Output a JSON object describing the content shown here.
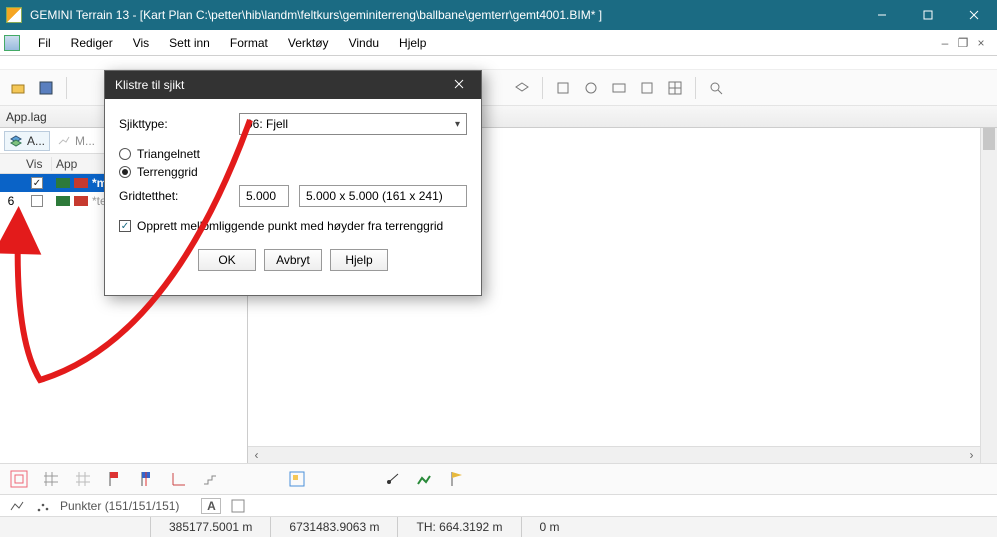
{
  "window": {
    "title": "GEMINI Terrain 13 - [Kart  Plan  C:\\petter\\hib\\landm\\feltkurs\\geminiterreng\\ballbane\\gemterr\\gemt4001.BIM* ]"
  },
  "menu": {
    "items": [
      "Fil",
      "Rediger",
      "Vis",
      "Sett inn",
      "Format",
      "Verktøy",
      "Vindu",
      "Hjelp"
    ]
  },
  "panel": {
    "heading": "App.lag",
    "tabs": {
      "active": "A...",
      "inactive": "M..."
    },
    "columns": {
      "vis": "Vis",
      "app": "App"
    },
    "rows": [
      {
        "idx": "",
        "checked": true,
        "swatch1": "#2d7a3a",
        "swatch2": "#c63a2f",
        "label": "*ma",
        "selected": true
      },
      {
        "idx": "6",
        "checked": false,
        "swatch1": "#2d7a3a",
        "swatch2": "#c63a2f",
        "label": "*terr",
        "selected": false
      }
    ]
  },
  "dialog": {
    "title": "Klistre til sjikt",
    "labels": {
      "sjikttype": "Sjikttype:",
      "gridtetthet": "Gridtetthet:"
    },
    "combo_value": "06: Fjell",
    "radio_triangelnett": "Triangelnett",
    "radio_terrenggrid": "Terrenggrid",
    "grid_value": "5.000",
    "grid_desc": "5.000 x 5.000 (161 x 241)",
    "checkbox": "Opprett mellomliggende punkt med høyder fra terrenggrid",
    "buttons": {
      "ok": "OK",
      "avbryt": "Avbryt",
      "hjelp": "Hjelp"
    }
  },
  "status": {
    "punkter": "Punkter  (151/151/151)",
    "a_label": "A"
  },
  "footer": {
    "x": "385177.5001 m",
    "y": "6731483.9063 m",
    "th": "TH: 664.3192 m",
    "z": "0 m"
  }
}
